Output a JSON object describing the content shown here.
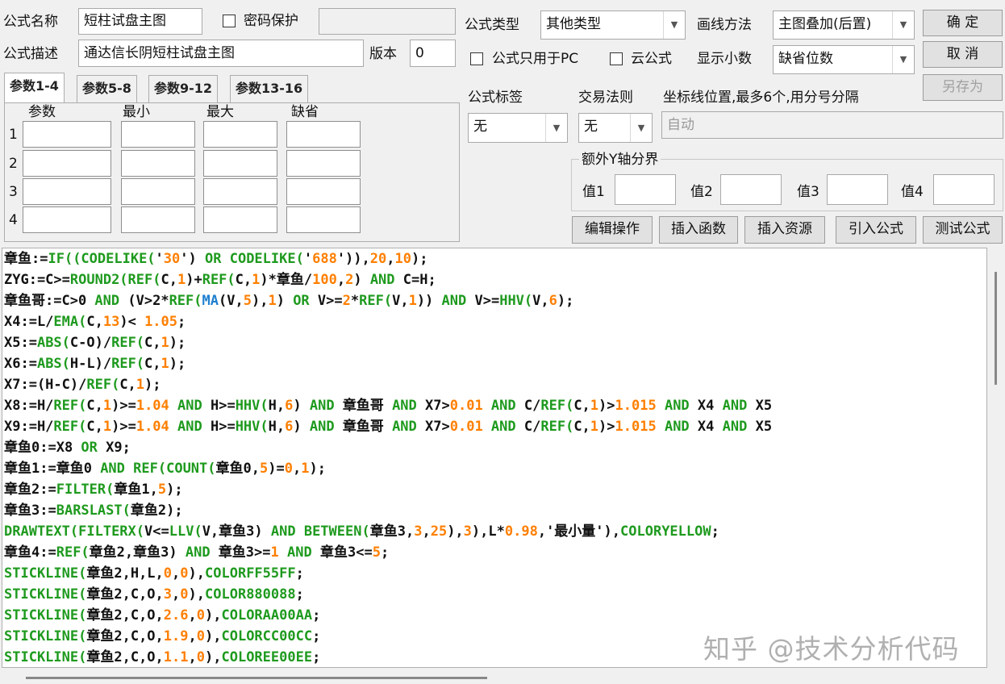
{
  "colors": {
    "keyword": "#1e9a1e",
    "number": "#ff7f00",
    "plain": "#111111",
    "blue": "#1e7fd0"
  },
  "header": {
    "name_label": "公式名称",
    "name_value": "短柱试盘主图",
    "password_label": "密码保护",
    "desc_label": "公式描述",
    "desc_value": "通达信长阴短柱试盘主图",
    "version_label": "版本",
    "version_value": "0",
    "type_label": "公式类型",
    "type_value": "其他类型",
    "draw_label": "画线方法",
    "draw_value": "主图叠加(后置)",
    "pc_only_label": "公式只用于PC",
    "cloud_label": "云公式",
    "decimal_label": "显示小数",
    "decimal_value": "缺省位数"
  },
  "buttons": {
    "ok": "确  定",
    "cancel": "取  消",
    "save_as": "另存为",
    "edit": "编辑操作",
    "insert_func": "插入函数",
    "insert_res": "插入资源",
    "import": "引入公式",
    "test": "测试公式"
  },
  "tabs": [
    "参数1-4",
    "参数5-8",
    "参数9-12",
    "参数13-16"
  ],
  "params": {
    "headers": [
      "参数",
      "最小",
      "最大",
      "缺省"
    ],
    "rows": [
      "1",
      "2",
      "3",
      "4"
    ]
  },
  "tag": {
    "label": "公式标签",
    "value": "无"
  },
  "rule": {
    "label": "交易法则",
    "value": "无"
  },
  "coord": {
    "label": "坐标线位置,最多6个,用分号分隔",
    "placeholder": "自动"
  },
  "yaxis": {
    "label": "额外Y轴分界",
    "values": [
      "值1",
      "值2",
      "值3",
      "值4"
    ]
  },
  "code": [
    [
      [
        "章鱼:=",
        "p"
      ],
      [
        "IF((CODELIKE(",
        "k"
      ],
      [
        "'",
        "p"
      ],
      [
        "30",
        "n"
      ],
      [
        "') ",
        "p"
      ],
      [
        "OR ",
        "k"
      ],
      [
        "CODELIKE(",
        "k"
      ],
      [
        "'",
        "p"
      ],
      [
        "688",
        "n"
      ],
      [
        "')),",
        "p"
      ],
      [
        "20",
        "n"
      ],
      [
        ",",
        "p"
      ],
      [
        "10",
        "n"
      ],
      [
        ");",
        "p"
      ]
    ],
    [
      [
        "ZYG:=C>=",
        "p"
      ],
      [
        "ROUND2(REF(",
        "k"
      ],
      [
        "C,",
        "p"
      ],
      [
        "1",
        "n"
      ],
      [
        ")+",
        "p"
      ],
      [
        "REF(",
        "k"
      ],
      [
        "C,",
        "p"
      ],
      [
        "1",
        "n"
      ],
      [
        ")*章鱼/",
        "p"
      ],
      [
        "100",
        "n"
      ],
      [
        ",",
        "p"
      ],
      [
        "2",
        "n"
      ],
      [
        ") ",
        "p"
      ],
      [
        "AND ",
        "k"
      ],
      [
        "C=H;",
        "p"
      ]
    ],
    [
      [
        "章鱼哥:=C>0 ",
        "p"
      ],
      [
        "AND ",
        "k"
      ],
      [
        "(V>2*",
        "p"
      ],
      [
        "REF(",
        "k"
      ],
      [
        "MA",
        "b"
      ],
      [
        "(V,",
        "p"
      ],
      [
        "5",
        "n"
      ],
      [
        "),",
        "p"
      ],
      [
        "1",
        "n"
      ],
      [
        ") ",
        "p"
      ],
      [
        "OR ",
        "k"
      ],
      [
        "V>=",
        "p"
      ],
      [
        "2",
        "n"
      ],
      [
        "*",
        "p"
      ],
      [
        "REF(",
        "k"
      ],
      [
        "V,",
        "p"
      ],
      [
        "1",
        "n"
      ],
      [
        ")) ",
        "p"
      ],
      [
        "AND ",
        "k"
      ],
      [
        "V>=",
        "p"
      ],
      [
        "HHV(",
        "k"
      ],
      [
        "V,",
        "p"
      ],
      [
        "6",
        "n"
      ],
      [
        ");",
        "p"
      ]
    ],
    [
      [
        "X4:=L/",
        "p"
      ],
      [
        "EMA(",
        "k"
      ],
      [
        "C,",
        "p"
      ],
      [
        "13",
        "n"
      ],
      [
        ")< ",
        "p"
      ],
      [
        "1.05",
        "n"
      ],
      [
        ";",
        "p"
      ]
    ],
    [
      [
        "X5:=",
        "p"
      ],
      [
        "ABS(",
        "k"
      ],
      [
        "C-O)/",
        "p"
      ],
      [
        "REF(",
        "k"
      ],
      [
        "C,",
        "p"
      ],
      [
        "1",
        "n"
      ],
      [
        ");",
        "p"
      ]
    ],
    [
      [
        "X6:=",
        "p"
      ],
      [
        "ABS(",
        "k"
      ],
      [
        "H-L)/",
        "p"
      ],
      [
        "REF(",
        "k"
      ],
      [
        "C,",
        "p"
      ],
      [
        "1",
        "n"
      ],
      [
        ");",
        "p"
      ]
    ],
    [
      [
        "X7:=(H-C)/",
        "p"
      ],
      [
        "REF(",
        "k"
      ],
      [
        "C,",
        "p"
      ],
      [
        "1",
        "n"
      ],
      [
        ");",
        "p"
      ]
    ],
    [
      [
        "X8:=H/",
        "p"
      ],
      [
        "REF(",
        "k"
      ],
      [
        "C,",
        "p"
      ],
      [
        "1",
        "n"
      ],
      [
        ")>=",
        "p"
      ],
      [
        "1.04 ",
        "n"
      ],
      [
        "AND ",
        "k"
      ],
      [
        "H>=",
        "p"
      ],
      [
        "HHV(",
        "k"
      ],
      [
        "H,",
        "p"
      ],
      [
        "6",
        "n"
      ],
      [
        ") ",
        "p"
      ],
      [
        "AND ",
        "k"
      ],
      [
        "章鱼哥 ",
        "p"
      ],
      [
        "AND ",
        "k"
      ],
      [
        "X7>",
        "p"
      ],
      [
        "0.01 ",
        "n"
      ],
      [
        "AND ",
        "k"
      ],
      [
        "C/",
        "p"
      ],
      [
        "REF(",
        "k"
      ],
      [
        "C,",
        "p"
      ],
      [
        "1",
        "n"
      ],
      [
        ")>",
        "p"
      ],
      [
        "1.015 ",
        "n"
      ],
      [
        "AND ",
        "k"
      ],
      [
        "X4 ",
        "p"
      ],
      [
        "AND ",
        "k"
      ],
      [
        "X5",
        "p"
      ]
    ],
    [
      [
        "X9:=H/",
        "p"
      ],
      [
        "REF(",
        "k"
      ],
      [
        "C,",
        "p"
      ],
      [
        "1",
        "n"
      ],
      [
        ")>=",
        "p"
      ],
      [
        "1.04 ",
        "n"
      ],
      [
        "AND ",
        "k"
      ],
      [
        "H>=",
        "p"
      ],
      [
        "HHV(",
        "k"
      ],
      [
        "H,",
        "p"
      ],
      [
        "6",
        "n"
      ],
      [
        ") ",
        "p"
      ],
      [
        "AND ",
        "k"
      ],
      [
        "章鱼哥 ",
        "p"
      ],
      [
        "AND ",
        "k"
      ],
      [
        "X7>",
        "p"
      ],
      [
        "0.01 ",
        "n"
      ],
      [
        "AND ",
        "k"
      ],
      [
        "C/",
        "p"
      ],
      [
        "REF(",
        "k"
      ],
      [
        "C,",
        "p"
      ],
      [
        "1",
        "n"
      ],
      [
        ")>",
        "p"
      ],
      [
        "1.015 ",
        "n"
      ],
      [
        "AND ",
        "k"
      ],
      [
        "X4 ",
        "p"
      ],
      [
        "AND ",
        "k"
      ],
      [
        "X5",
        "p"
      ]
    ],
    [
      [
        "章鱼0:=X8 ",
        "p"
      ],
      [
        "OR ",
        "k"
      ],
      [
        "X9;",
        "p"
      ]
    ],
    [
      [
        "章鱼1:=章鱼0 ",
        "p"
      ],
      [
        "AND ",
        "k"
      ],
      [
        "REF(",
        "k"
      ],
      [
        "COUNT(",
        "k"
      ],
      [
        "章鱼0,",
        "p"
      ],
      [
        "5",
        "n"
      ],
      [
        ")=",
        "p"
      ],
      [
        "0",
        "n"
      ],
      [
        ",",
        "p"
      ],
      [
        "1",
        "n"
      ],
      [
        ");",
        "p"
      ]
    ],
    [
      [
        "章鱼2:=",
        "p"
      ],
      [
        "FILTER(",
        "k"
      ],
      [
        "章鱼1,",
        "p"
      ],
      [
        "5",
        "n"
      ],
      [
        ");",
        "p"
      ]
    ],
    [
      [
        "章鱼3:=",
        "p"
      ],
      [
        "BARSLAST(",
        "k"
      ],
      [
        "章鱼2);",
        "p"
      ]
    ],
    [
      [
        "DRAWTEXT(",
        "k"
      ],
      [
        "FILTERX(",
        "k"
      ],
      [
        "V<=",
        "p"
      ],
      [
        "LLV(",
        "k"
      ],
      [
        "V,章鱼3) ",
        "p"
      ],
      [
        "AND ",
        "k"
      ],
      [
        "BETWEEN(",
        "k"
      ],
      [
        "章鱼3,",
        "p"
      ],
      [
        "3",
        "n"
      ],
      [
        ",",
        "p"
      ],
      [
        "25",
        "n"
      ],
      [
        "),",
        "p"
      ],
      [
        "3",
        "n"
      ],
      [
        "),L*",
        "p"
      ],
      [
        "0.98",
        "n"
      ],
      [
        ",'最小量'),",
        "p"
      ],
      [
        "COLORYELLOW",
        "k"
      ],
      [
        ";",
        "p"
      ]
    ],
    [
      [
        "章鱼4:=",
        "p"
      ],
      [
        "REF(",
        "k"
      ],
      [
        "章鱼2,章鱼3) ",
        "p"
      ],
      [
        "AND ",
        "k"
      ],
      [
        "章鱼3>=",
        "p"
      ],
      [
        "1 ",
        "n"
      ],
      [
        "AND ",
        "k"
      ],
      [
        "章鱼3<=",
        "p"
      ],
      [
        "5",
        "n"
      ],
      [
        ";",
        "p"
      ]
    ],
    [
      [
        "STICKLINE(",
        "k"
      ],
      [
        "章鱼2,H,L,",
        "p"
      ],
      [
        "0",
        "n"
      ],
      [
        ",",
        "p"
      ],
      [
        "0",
        "n"
      ],
      [
        "),",
        "p"
      ],
      [
        "COLORFF55FF",
        "k"
      ],
      [
        ";",
        "p"
      ]
    ],
    [
      [
        "STICKLINE(",
        "k"
      ],
      [
        "章鱼2,C,O,",
        "p"
      ],
      [
        "3",
        "n"
      ],
      [
        ",",
        "p"
      ],
      [
        "0",
        "n"
      ],
      [
        "),",
        "p"
      ],
      [
        "COLOR880088",
        "k"
      ],
      [
        ";",
        "p"
      ]
    ],
    [
      [
        "STICKLINE(",
        "k"
      ],
      [
        "章鱼2,C,O,",
        "p"
      ],
      [
        "2.6",
        "n"
      ],
      [
        ",",
        "p"
      ],
      [
        "0",
        "n"
      ],
      [
        "),",
        "p"
      ],
      [
        "COLORAA00AA",
        "k"
      ],
      [
        ";",
        "p"
      ]
    ],
    [
      [
        "STICKLINE(",
        "k"
      ],
      [
        "章鱼2,C,O,",
        "p"
      ],
      [
        "1.9",
        "n"
      ],
      [
        ",",
        "p"
      ],
      [
        "0",
        "n"
      ],
      [
        "),",
        "p"
      ],
      [
        "COLORCC00CC",
        "k"
      ],
      [
        ";",
        "p"
      ]
    ],
    [
      [
        "STICKLINE(",
        "k"
      ],
      [
        "章鱼2,C,O,",
        "p"
      ],
      [
        "1.1",
        "n"
      ],
      [
        ",",
        "p"
      ],
      [
        "0",
        "n"
      ],
      [
        "),",
        "p"
      ],
      [
        "COLOREE00EE",
        "k"
      ],
      [
        ";",
        "p"
      ]
    ]
  ],
  "watermark": "知乎 @技术分析代码"
}
